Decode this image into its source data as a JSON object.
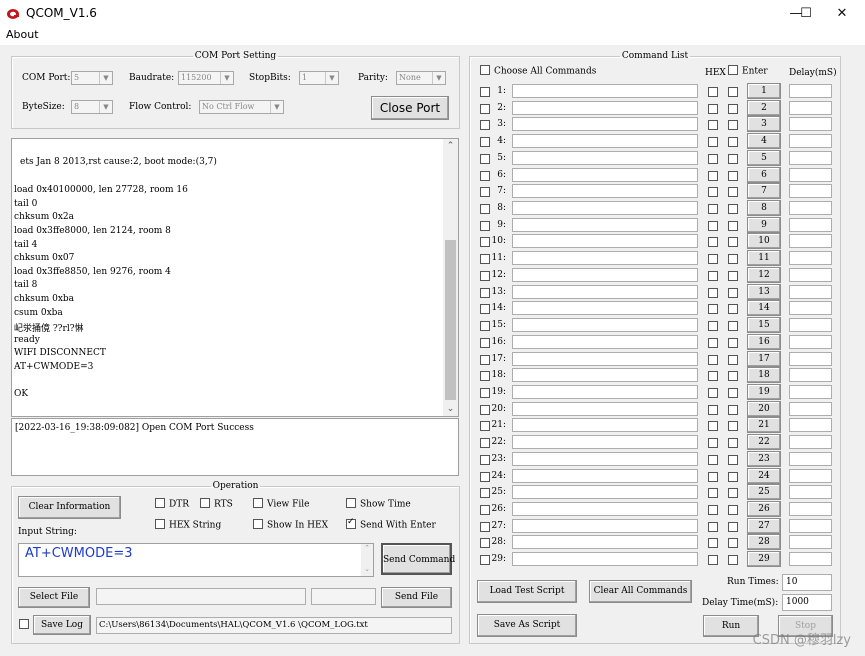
{
  "window": {
    "title": "QCOM_V1.6",
    "minimize": "—",
    "maximize": "☐",
    "close": "✕"
  },
  "menu": {
    "about": "About"
  },
  "com_port": {
    "legend": "COM Port Setting",
    "com_port_label": "COM Port:",
    "com_port_value": "5",
    "baudrate_label": "Baudrate:",
    "baudrate_value": "115200",
    "stopbits_label": "StopBits:",
    "stopbits_value": "1",
    "parity_label": "Parity:",
    "parity_value": "None",
    "bytesize_label": "ByteSize:",
    "bytesize_value": "8",
    "flow_label": "Flow Control:",
    "flow_value": "No Ctrl Flow",
    "close_port": "Close Port"
  },
  "receive_lines": [
    "ets Jan  8 2013,rst cause:2, boot mode:(3,7)",
    "",
    "load 0x40100000, len 27728, room 16",
    "tail 0",
    "chksum 0x2a",
    "load 0x3ffe8000, len 2124, room 8",
    "tail 4",
    "chksum 0x07",
    "load 0x3ffe8850, len 9276, room 4",
    "tail 8",
    "chksum 0xba",
    "csum 0xba",
    "屺泶捅傹  ??rl?惏",
    "ready",
    "WIFI DISCONNECT",
    "AT+CWMODE=3",
    "",
    "OK"
  ],
  "log_text": "[2022-03-16_19:38:09:082] Open COM Port Success",
  "operation": {
    "legend": "Operation",
    "clear_information": "Clear Information",
    "dtr": "DTR",
    "rts": "RTS",
    "view_file": "View File",
    "show_time": "Show Time",
    "hex_string": "HEX String",
    "show_in_hex": "Show In HEX",
    "send_with_enter": "Send With Enter",
    "input_string_label": "Input String:",
    "input_value": "AT+CWMODE=3",
    "send_command": "Send Command",
    "select_file": "Select File",
    "send_file": "Send File",
    "save_log": "Save Log",
    "log_path": "C:\\Users\\86134\\Documents\\HAL\\QCOM_V1.6 \\QCOM_LOG.txt"
  },
  "command_list": {
    "legend": "Command List",
    "choose_all": "Choose All Commands",
    "hex": "HEX",
    "enter": "Enter",
    "delay": "Delay(mS)",
    "rows": [
      "1:",
      "2:",
      "3:",
      "4:",
      "5:",
      "6:",
      "7:",
      "8:",
      "9:",
      "10:",
      "11:",
      "12:",
      "13:",
      "14:",
      "15:",
      "16:",
      "17:",
      "18:",
      "19:",
      "20:",
      "21:",
      "22:",
      "23:",
      "24:",
      "25:",
      "26:",
      "27:",
      "28:",
      "29:"
    ],
    "buttons": [
      "1",
      "2",
      "3",
      "4",
      "5",
      "6",
      "7",
      "8",
      "9",
      "10",
      "11",
      "12",
      "13",
      "14",
      "15",
      "16",
      "17",
      "18",
      "19",
      "20",
      "21",
      "22",
      "23",
      "24",
      "25",
      "26",
      "27",
      "28",
      "29"
    ],
    "load_test_script": "Load Test Script",
    "clear_all_commands": "Clear All Commands",
    "save_as_script": "Save As Script",
    "run_times_label": "Run Times:",
    "run_times_value": "10",
    "delay_time_label": "Delay Time(mS):",
    "delay_time_value": "1000",
    "run": "Run",
    "stop": "Stop"
  },
  "watermark": "CSDN @穆羽lzy"
}
